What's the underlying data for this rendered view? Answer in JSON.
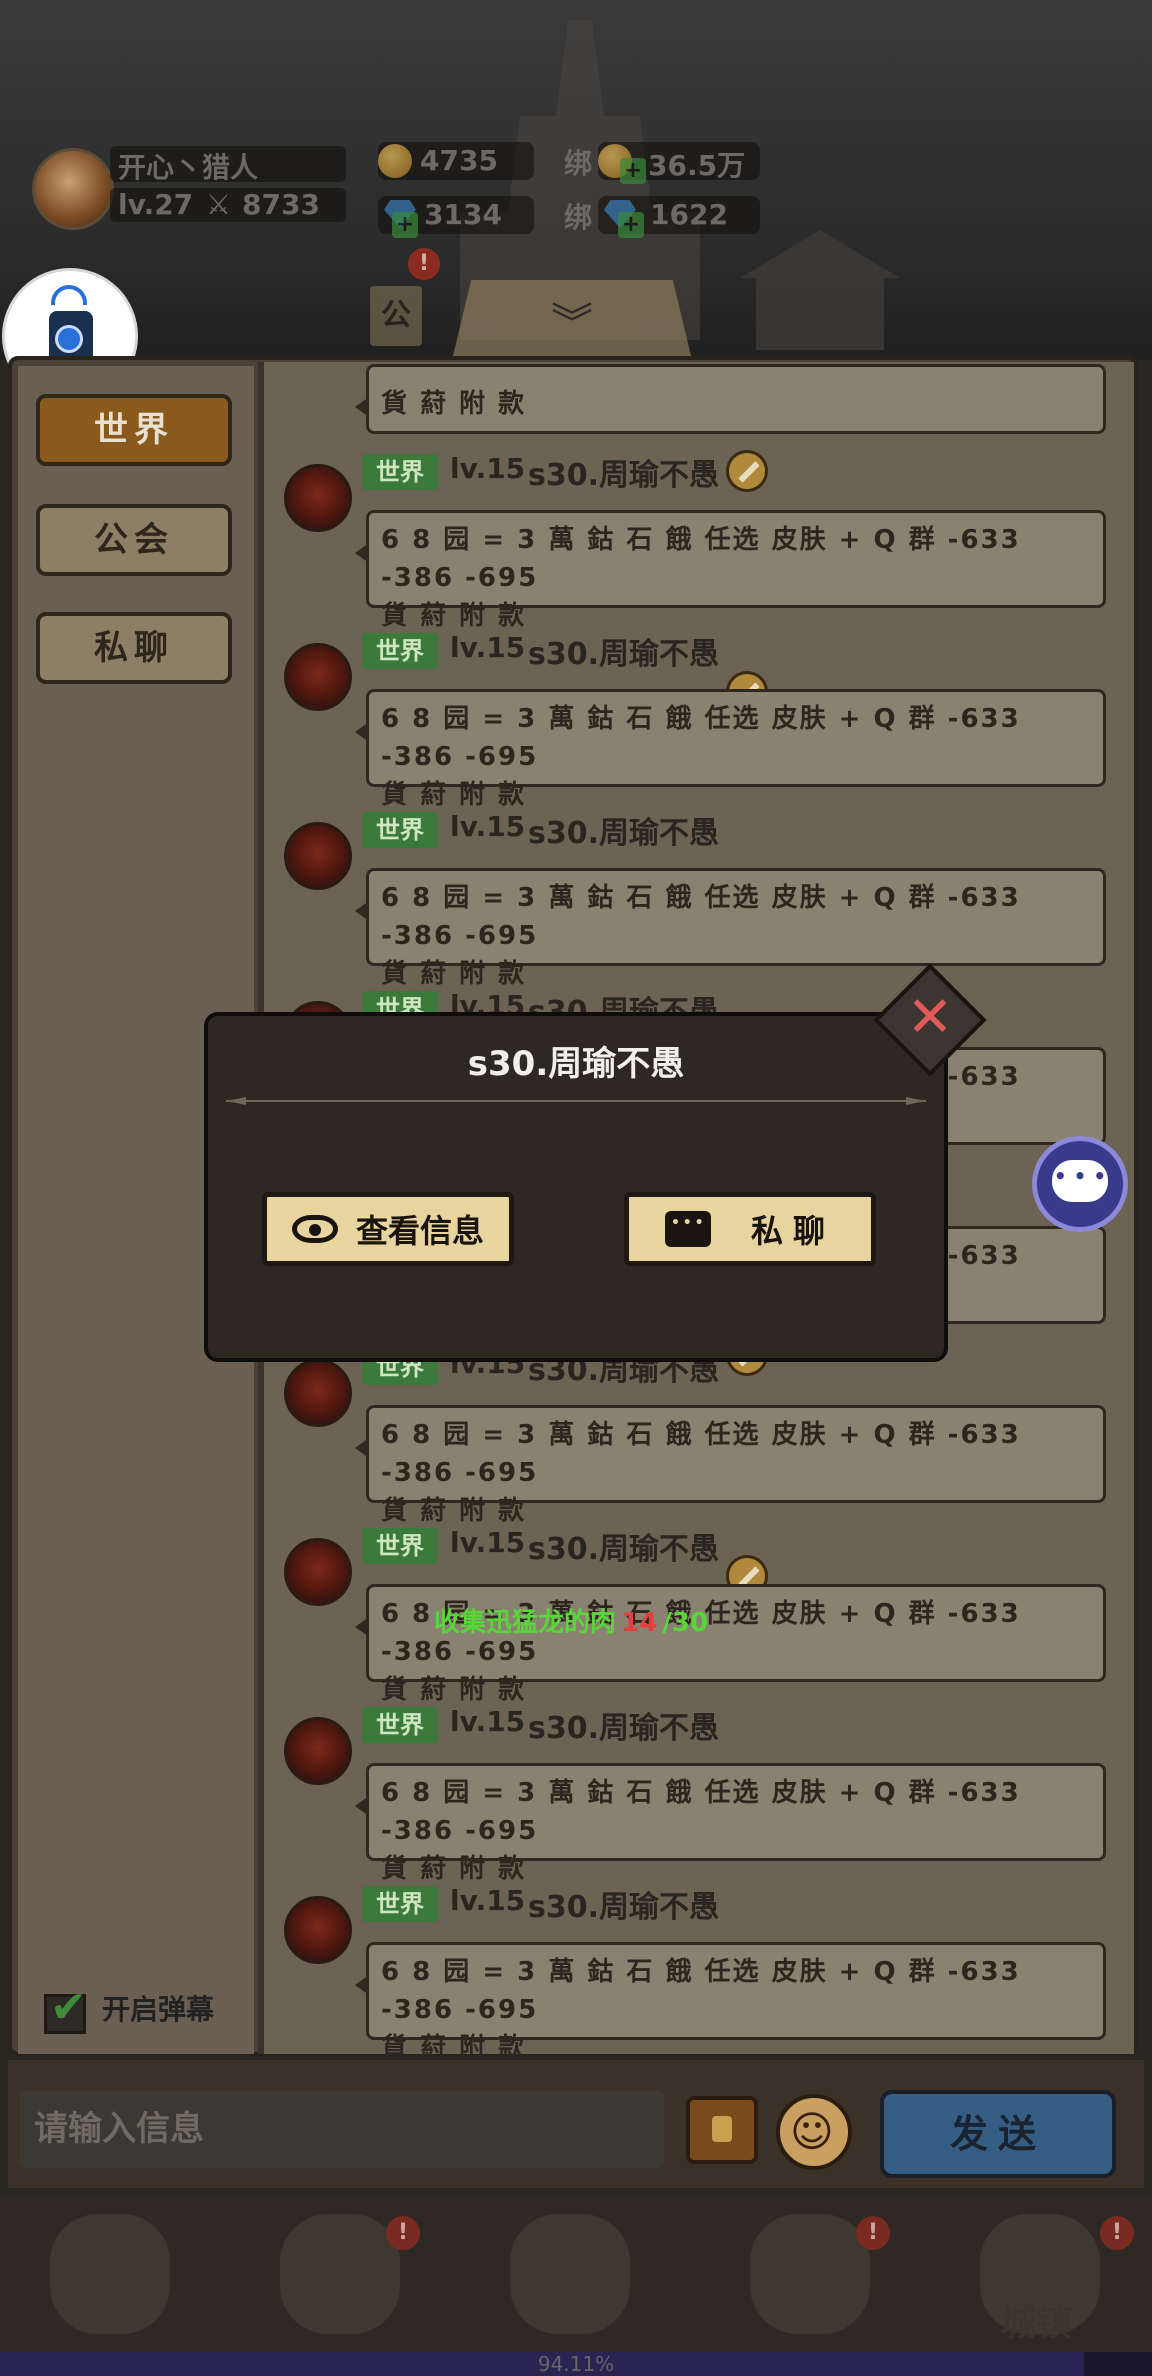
{
  "hud": {
    "player_name": "开心丶猎人",
    "level": "lv.27",
    "power": "8733",
    "gold": "4735",
    "bind_label": "绑",
    "bound_gold": "36.5万",
    "diamonds": "3134",
    "bound_diamonds": "1622",
    "notification_badge": "!",
    "guild_tab": "公",
    "collapse_icon": "chevron-down-icon"
  },
  "tabs": [
    {
      "label": "世界",
      "active": true
    },
    {
      "label": "公会",
      "active": false
    },
    {
      "label": "私聊",
      "active": false
    }
  ],
  "barrage": {
    "label": "开启弹幕",
    "checked": true
  },
  "messages": {
    "partial_text": "貨 葤 附 款",
    "tag": "世界",
    "level": "lv.15",
    "name": "s30.周瑜不愚",
    "text_line1": "6 8 园 = 3 萬 鈷 石 餓 任选 皮肤 + Q 群 -633 -386 -695",
    "text_line2": "貨 葤 附 款",
    "count": 9
  },
  "quest": {
    "label": "收集迅猛龙的肉",
    "current": "14",
    "total": "/30"
  },
  "modal": {
    "title": "s30.周瑜不愚",
    "view_button": "查看信息",
    "chat_button": "私聊",
    "close_icon": "close-icon"
  },
  "input": {
    "placeholder": "请输入信息",
    "send_label": "发送"
  },
  "nav": {
    "town_label": "城镇",
    "badge": "!"
  },
  "progress": {
    "text": "94.11%",
    "value": 0.9411
  },
  "colors": {
    "tab_active": "#8a5a1c",
    "tag_world": "#3b7a3a",
    "quest_green": "#5ad63a",
    "quest_red": "#e04040",
    "modal_button": "#e8d49e"
  }
}
